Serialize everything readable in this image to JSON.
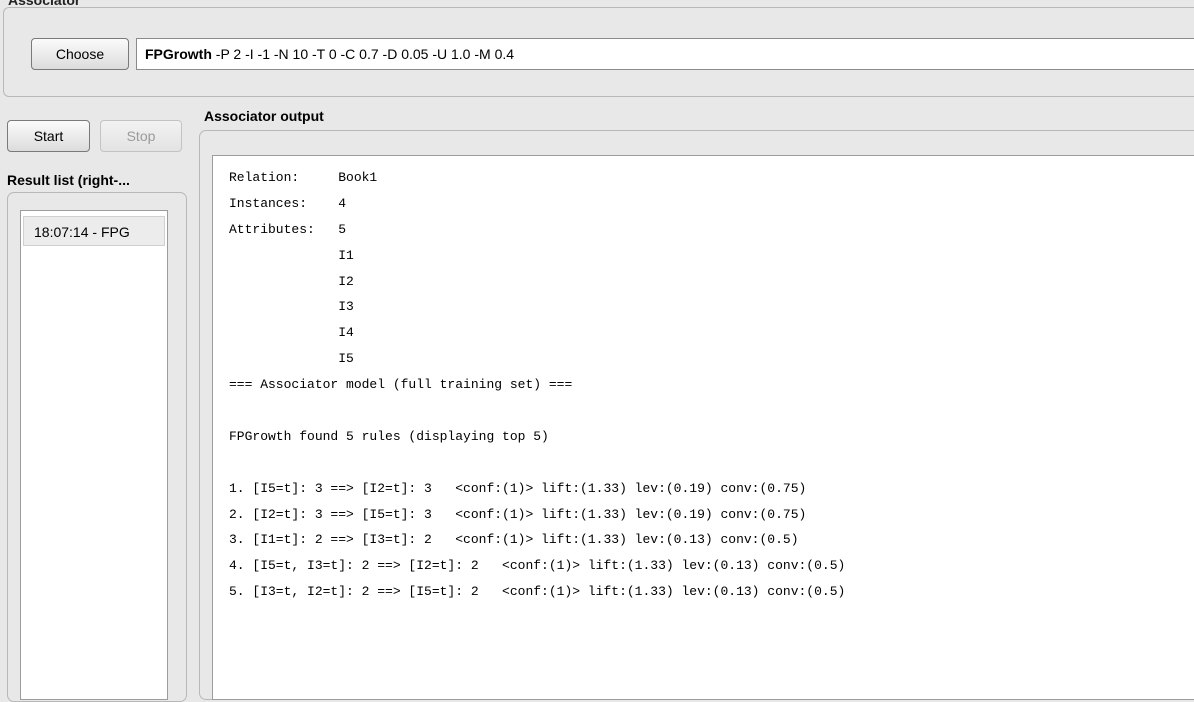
{
  "header": {
    "title": "Associator"
  },
  "associator": {
    "choose_label": "Choose",
    "scheme_name": "FPGrowth",
    "scheme_options": " -P 2 -I -1 -N 10 -T 0 -C 0.7 -D 0.05 -U 1.0 -M 0.4"
  },
  "controls": {
    "start_label": "Start",
    "stop_label": "Stop"
  },
  "result_list": {
    "label": "Result list (right-...",
    "items": [
      {
        "label": "18:07:14 - FPG"
      }
    ]
  },
  "output": {
    "label": "Associator output",
    "lines": [
      "Relation:     Book1",
      "Instances:    4",
      "Attributes:   5",
      "              I1",
      "              I2",
      "              I3",
      "              I4",
      "              I5",
      "=== Associator model (full training set) ===",
      "",
      "FPGrowth found 5 rules (displaying top 5)",
      "",
      "1. [I5=t]: 3 ==> [I2=t]: 3   <conf:(1)> lift:(1.33) lev:(0.19) conv:(0.75)",
      "2. [I2=t]: 3 ==> [I5=t]: 3   <conf:(1)> lift:(1.33) lev:(0.19) conv:(0.75)",
      "3. [I1=t]: 2 ==> [I3=t]: 2   <conf:(1)> lift:(1.33) lev:(0.13) conv:(0.5)",
      "4. [I5=t, I3=t]: 2 ==> [I2=t]: 2   <conf:(1)> lift:(1.33) lev:(0.13) conv:(0.5)",
      "5. [I3=t, I2=t]: 2 ==> [I5=t]: 2   <conf:(1)> lift:(1.33) lev:(0.13) conv:(0.5)"
    ]
  }
}
